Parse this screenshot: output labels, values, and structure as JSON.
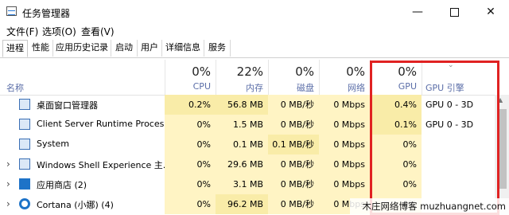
{
  "window": {
    "title": "任务管理器"
  },
  "menu": [
    "文件(F)",
    "选项(O)",
    "查看(V)"
  ],
  "tabs": [
    "进程",
    "性能",
    "应用历史记录",
    "启动",
    "用户",
    "详细信息",
    "服务"
  ],
  "active_tab": "进程",
  "columns": {
    "name": {
      "label": "名称"
    },
    "cpu": {
      "pct": "0%",
      "label": "CPU"
    },
    "memory": {
      "pct": "22%",
      "label": "内存"
    },
    "disk": {
      "pct": "0%",
      "label": "磁盘"
    },
    "network": {
      "pct": "0%",
      "label": "网络"
    },
    "gpu": {
      "pct": "0%",
      "label": "GPU"
    },
    "gpu_engine": {
      "label": "GPU 引擎"
    }
  },
  "processes": [
    {
      "name": "桌面窗口管理器",
      "cpu": "0.2%",
      "memory": "56.8 MB",
      "disk": "0 MB/秒",
      "network": "0 Mbps",
      "gpu": "0.4%",
      "gpu_engine": "GPU 0 - 3D",
      "expandable": false
    },
    {
      "name": "Client Server Runtime Process",
      "cpu": "0%",
      "memory": "1.5 MB",
      "disk": "0 MB/秒",
      "network": "0 Mbps",
      "gpu": "0.1%",
      "gpu_engine": "GPU 0 - 3D",
      "expandable": false
    },
    {
      "name": "System",
      "cpu": "0%",
      "memory": "0.1 MB",
      "disk": "0.1 MB/秒",
      "network": "0 Mbps",
      "gpu": "0%",
      "gpu_engine": "",
      "expandable": false
    },
    {
      "name": "Windows Shell Experience 主...",
      "cpu": "0%",
      "memory": "29.6 MB",
      "disk": "0 MB/秒",
      "network": "0 Mbps",
      "gpu": "0%",
      "gpu_engine": "",
      "expandable": true
    },
    {
      "name": "应用商店 (2)",
      "cpu": "0%",
      "memory": "3.1 MB",
      "disk": "0 MB/秒",
      "network": "0 Mbps",
      "gpu": "0%",
      "gpu_engine": "",
      "expandable": true
    },
    {
      "name": "Cortana (小娜) (4)",
      "cpu": "0%",
      "memory": "96.2 MB",
      "disk": "0 MB/秒",
      "network": "0 Mbps",
      "gpu": "0%",
      "gpu_engine": "",
      "expandable": true
    }
  ],
  "watermark": "木庄网络博客 muzhuangnet.com",
  "colors": {
    "highlight_box": "#e02222",
    "column_label": "#5b6ea8",
    "heat_light": "#fff4c4",
    "heat_strong": "#f9eca8"
  }
}
